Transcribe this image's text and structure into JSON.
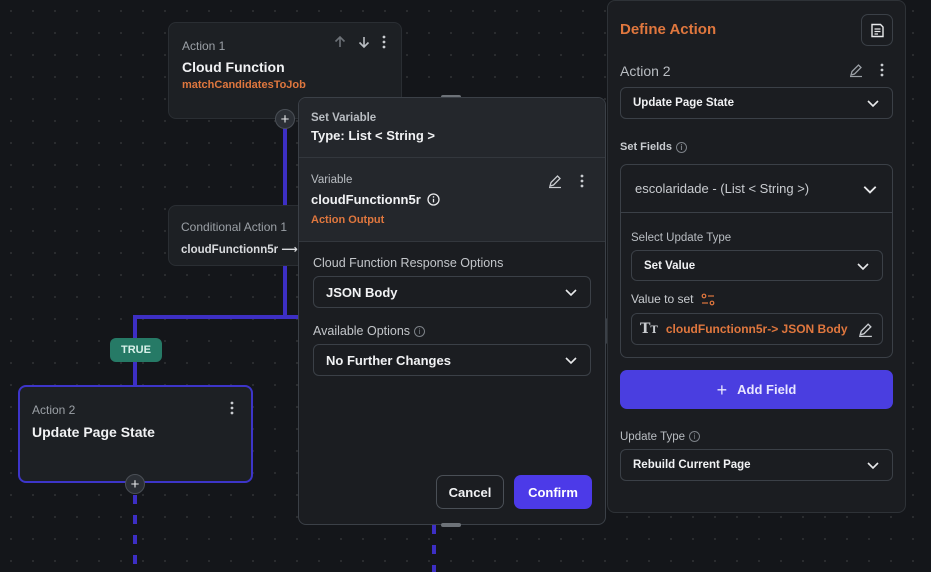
{
  "action1": {
    "label": "Action 1",
    "title": "Cloud Function",
    "subtitle": "matchCandidatesToJob",
    "icons": [
      "arrow-up-icon",
      "arrow-down-icon",
      "more-vertical-icon"
    ]
  },
  "conditional": {
    "label": "Conditional Action 1",
    "value": "cloudFunctionn5r ⟶"
  },
  "true_badge": "TRUE",
  "action2_node": {
    "label": "Action 2",
    "title": "Update Page State"
  },
  "popup": {
    "header_label": "Set Variable",
    "header_type": "Type: List < String >",
    "variable_label": "Variable",
    "variable_name": "cloudFunctionn5r",
    "variable_source": "Action Output",
    "response_label": "Cloud Function Response Options",
    "response_value": "JSON Body",
    "available_label": "Available Options",
    "available_value": "No Further Changes",
    "cancel_label": "Cancel",
    "confirm_label": "Confirm"
  },
  "panel": {
    "title": "Define Action",
    "action_label": "Action 2",
    "action_value": "Update Page State",
    "set_fields_label": "Set Fields",
    "field_name": "escolaridade - (List < String >)",
    "update_type_label": "Select Update Type",
    "update_type_value": "Set Value",
    "value_to_set_label": "Value to set",
    "value_to_set": "cloudFunctionn5r-> JSON Body",
    "add_field_label": "Add Field",
    "update_type2_label": "Update Type",
    "update_type2_value": "Rebuild Current Page"
  },
  "colors": {
    "accent": "#4a3ee0",
    "connector": "#3d2fc4",
    "orange": "#e0773e",
    "true_badge": "#267a66"
  }
}
